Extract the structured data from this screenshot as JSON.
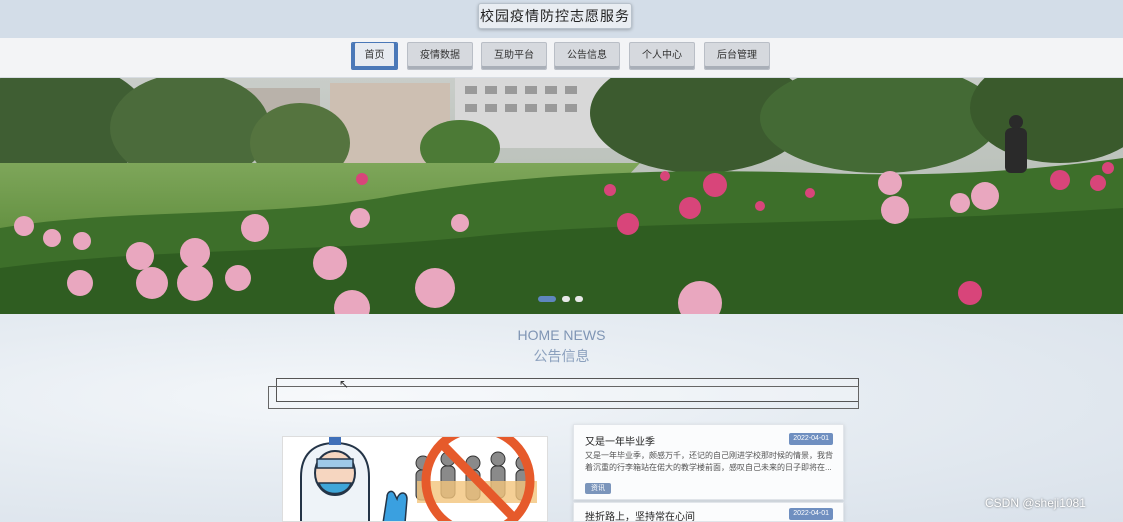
{
  "header": {
    "site_title": "校园疫情防控志愿服务"
  },
  "nav": {
    "items": [
      {
        "label": "首页",
        "active": true
      },
      {
        "label": "疫情数据",
        "active": false
      },
      {
        "label": "互助平台",
        "active": false
      },
      {
        "label": "公告信息",
        "active": false
      },
      {
        "label": "个人中心",
        "active": false
      },
      {
        "label": "后台管理",
        "active": false
      }
    ]
  },
  "banner": {
    "slide_count": 3,
    "active_slide": 1
  },
  "news_section": {
    "title_en": "HOME NEWS",
    "title_cn": "公告信息",
    "cards": [
      {
        "title": "又是一年毕业季",
        "date": "2022-04-01",
        "summary": "又是一年毕业季，颇感万千，还记的自己刚进学校那时候的情景，我背着沉重的行李箱站在偌大的教学楼前面，感叹自己未来的日子即将在...",
        "tag": "资讯"
      },
      {
        "title": "挫折路上，坚持常在心间",
        "date": "2022-04-01"
      }
    ]
  },
  "watermark": "CSDN @sheji1081",
  "colors": {
    "accent": "#5f86bf",
    "date_badge": "#6f8fc0"
  }
}
